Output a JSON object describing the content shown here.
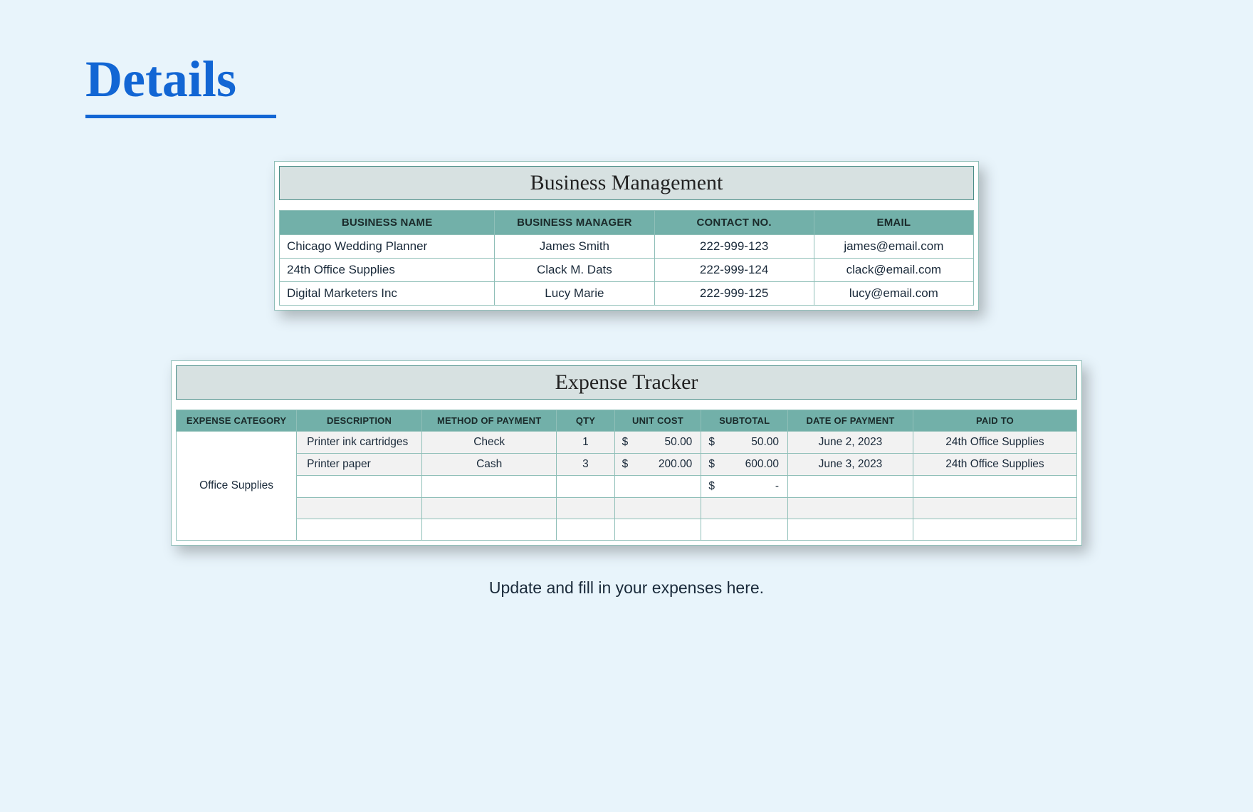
{
  "page": {
    "title": "Details",
    "caption": "Update and fill in your expenses here."
  },
  "business": {
    "title": "Business Management",
    "headers": [
      "BUSINESS NAME",
      "BUSINESS MANAGER",
      "CONTACT NO.",
      "EMAIL"
    ],
    "rows": [
      {
        "name": "Chicago Wedding Planner",
        "manager": "James Smith",
        "contact": "222-999-123",
        "email": "james@email.com"
      },
      {
        "name": "24th Office Supplies",
        "manager": "Clack M. Dats",
        "contact": "222-999-124",
        "email": "clack@email.com"
      },
      {
        "name": "Digital Marketers Inc",
        "manager": "Lucy Marie",
        "contact": "222-999-125",
        "email": "lucy@email.com"
      }
    ]
  },
  "expense": {
    "title": "Expense Tracker",
    "headers": [
      "EXPENSE CATEGORY",
      "DESCRIPTION",
      "METHOD OF PAYMENT",
      "QTY",
      "UNIT COST",
      "SUBTOTAL",
      "DATE OF PAYMENT",
      "PAID TO"
    ],
    "category": "Office Supplies",
    "currency": "$",
    "rows": [
      {
        "desc": "Printer ink cartridges",
        "method": "Check",
        "qty": "1",
        "unit": "50.00",
        "sub": "50.00",
        "date": "June 2, 2023",
        "paid": "24th Office Supplies"
      },
      {
        "desc": "Printer paper",
        "method": "Cash",
        "qty": "3",
        "unit": "200.00",
        "sub": "600.00",
        "date": "June 3, 2023",
        "paid": "24th Office Supplies"
      },
      {
        "desc": "",
        "method": "",
        "qty": "",
        "unit": "",
        "sub": "-",
        "date": "",
        "paid": ""
      },
      {
        "desc": "",
        "method": "",
        "qty": "",
        "unit": "",
        "sub": "",
        "date": "",
        "paid": ""
      },
      {
        "desc": "",
        "method": "",
        "qty": "",
        "unit": "",
        "sub": "",
        "date": "",
        "paid": ""
      }
    ]
  }
}
